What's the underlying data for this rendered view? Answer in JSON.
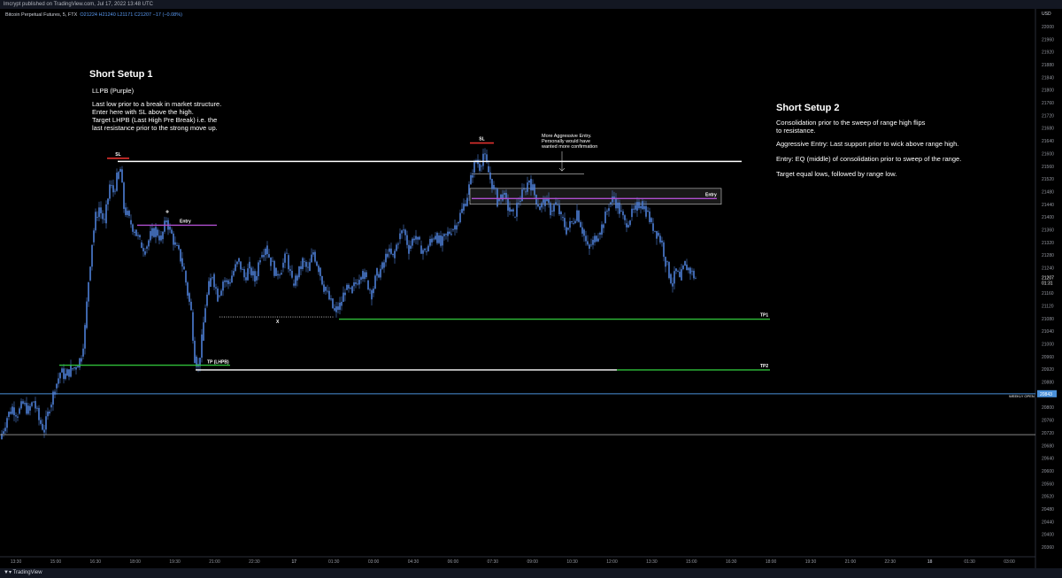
{
  "header": {
    "published": "lmcrypt published on TradingView.com, Jul 17, 2022 13:48 UTC",
    "symbol": "Bitcoin Perpetual Futures, 5, FTX",
    "ohlc_o": "O21224",
    "ohlc_h": "H21240",
    "ohlc_l": "L21171",
    "ohlc_c": "C21207",
    "change": "−17 (−0.08%)"
  },
  "footer": {
    "brand": "TradingView"
  },
  "colors": {
    "background": "#000000",
    "candle": "#4e7fd6",
    "white_line": "#ffffff",
    "green_line": "#2fbf3a",
    "purple_line": "#b04fd1",
    "red_line": "#e0312e",
    "weekly_open_line": "#4a90d9",
    "box_fill": "#2a2a2a",
    "box_border": "#cfcfcf"
  },
  "chart_data": {
    "type": "candlestick",
    "currency": "USD",
    "ylim": [
      20340,
      22040
    ],
    "y_ticks": [
      22000,
      21960,
      21920,
      21880,
      21840,
      21800,
      21760,
      21720,
      21680,
      21640,
      21600,
      21560,
      21520,
      21480,
      21440,
      21400,
      21360,
      21320,
      21280,
      21240,
      21200,
      21160,
      21120,
      21080,
      21040,
      21000,
      20960,
      20920,
      20880,
      20840,
      20800,
      20760,
      20720,
      20680,
      20640,
      20600,
      20560,
      20520,
      20480,
      20440,
      20400,
      20360
    ],
    "x_ticks": [
      "13:30",
      "15:00",
      "16:30",
      "18:00",
      "19:30",
      "21:00",
      "22:30",
      "17",
      "01:30",
      "03:00",
      "04:30",
      "06:00",
      "07:30",
      "09:00",
      "10:30",
      "12:00",
      "13:30",
      "15:00",
      "16:30",
      "18:00",
      "19:30",
      "21:00",
      "22:30",
      "18",
      "01:30",
      "03:00"
    ],
    "last_price_label": "21207",
    "countdown_label": "01:31",
    "weekly_open": {
      "value": 20843,
      "label": "20843",
      "tag": "WEEKLY OPEN"
    },
    "close_path": [
      [
        0,
        20700
      ],
      [
        8,
        20770
      ],
      [
        14,
        20800
      ],
      [
        20,
        20780
      ],
      [
        26,
        20810
      ],
      [
        32,
        20790
      ],
      [
        38,
        20820
      ],
      [
        44,
        20760
      ],
      [
        50,
        20730
      ],
      [
        56,
        20800
      ],
      [
        62,
        20860
      ],
      [
        68,
        20910
      ],
      [
        74,
        20900
      ],
      [
        80,
        20920
      ],
      [
        86,
        20930
      ],
      [
        92,
        20960
      ],
      [
        96,
        21050
      ],
      [
        100,
        21200
      ],
      [
        104,
        21320
      ],
      [
        108,
        21400
      ],
      [
        112,
        21430
      ],
      [
        118,
        21380
      ],
      [
        124,
        21500
      ],
      [
        128,
        21480
      ],
      [
        132,
        21520
      ],
      [
        136,
        21550
      ],
      [
        140,
        21430
      ],
      [
        146,
        21390
      ],
      [
        152,
        21360
      ],
      [
        158,
        21320
      ],
      [
        164,
        21300
      ],
      [
        170,
        21340
      ],
      [
        176,
        21360
      ],
      [
        182,
        21330
      ],
      [
        188,
        21390
      ],
      [
        192,
        21360
      ],
      [
        198,
        21310
      ],
      [
        204,
        21270
      ],
      [
        208,
        21230
      ],
      [
        212,
        21160
      ],
      [
        216,
        21100
      ],
      [
        220,
        20960
      ],
      [
        224,
        20930
      ],
      [
        228,
        21010
      ],
      [
        232,
        21120
      ],
      [
        236,
        21180
      ],
      [
        240,
        21220
      ],
      [
        246,
        21150
      ],
      [
        252,
        21200
      ],
      [
        258,
        21190
      ],
      [
        264,
        21230
      ],
      [
        270,
        21260
      ],
      [
        276,
        21210
      ],
      [
        282,
        21240
      ],
      [
        288,
        21200
      ],
      [
        294,
        21280
      ],
      [
        300,
        21310
      ],
      [
        306,
        21260
      ],
      [
        312,
        21220
      ],
      [
        318,
        21240
      ],
      [
        324,
        21280
      ],
      [
        330,
        21190
      ],
      [
        336,
        21210
      ],
      [
        342,
        21260
      ],
      [
        348,
        21230
      ],
      [
        354,
        21290
      ],
      [
        360,
        21240
      ],
      [
        366,
        21180
      ],
      [
        372,
        21140
      ],
      [
        378,
        21100
      ],
      [
        384,
        21120
      ],
      [
        390,
        21170
      ],
      [
        396,
        21160
      ],
      [
        402,
        21190
      ],
      [
        408,
        21230
      ],
      [
        414,
        21200
      ],
      [
        420,
        21160
      ],
      [
        426,
        21220
      ],
      [
        432,
        21240
      ],
      [
        438,
        21290
      ],
      [
        444,
        21270
      ],
      [
        450,
        21330
      ],
      [
        456,
        21360
      ],
      [
        462,
        21300
      ],
      [
        468,
        21340
      ],
      [
        474,
        21310
      ],
      [
        480,
        21290
      ],
      [
        486,
        21320
      ],
      [
        492,
        21350
      ],
      [
        498,
        21310
      ],
      [
        504,
        21340
      ],
      [
        510,
        21360
      ],
      [
        516,
        21380
      ],
      [
        522,
        21420
      ],
      [
        528,
        21470
      ],
      [
        534,
        21540
      ],
      [
        538,
        21580
      ],
      [
        542,
        21560
      ],
      [
        546,
        21600
      ],
      [
        550,
        21560
      ],
      [
        554,
        21520
      ],
      [
        558,
        21490
      ],
      [
        562,
        21450
      ],
      [
        568,
        21470
      ],
      [
        574,
        21430
      ],
      [
        580,
        21400
      ],
      [
        586,
        21450
      ],
      [
        592,
        21480
      ],
      [
        598,
        21520
      ],
      [
        604,
        21470
      ],
      [
        610,
        21430
      ],
      [
        616,
        21450
      ],
      [
        622,
        21420
      ],
      [
        628,
        21440
      ],
      [
        634,
        21400
      ],
      [
        640,
        21360
      ],
      [
        646,
        21380
      ],
      [
        652,
        21420
      ],
      [
        658,
        21360
      ],
      [
        664,
        21300
      ],
      [
        670,
        21320
      ],
      [
        676,
        21350
      ],
      [
        682,
        21380
      ],
      [
        688,
        21440
      ],
      [
        694,
        21460
      ],
      [
        700,
        21420
      ],
      [
        706,
        21380
      ],
      [
        712,
        21400
      ],
      [
        718,
        21420
      ],
      [
        724,
        21450
      ],
      [
        730,
        21420
      ],
      [
        736,
        21380
      ],
      [
        742,
        21350
      ],
      [
        748,
        21320
      ],
      [
        752,
        21260
      ],
      [
        756,
        21220
      ],
      [
        760,
        21190
      ],
      [
        764,
        21230
      ],
      [
        768,
        21200
      ],
      [
        774,
        21250
      ],
      [
        780,
        21230
      ],
      [
        786,
        21207
      ]
    ],
    "levels": [
      {
        "name": "SL range high",
        "value": 21575,
        "color": "white",
        "x1": 133,
        "x2": 838,
        "label": ""
      },
      {
        "name": "TP1",
        "value": 21078,
        "color": "green",
        "x1": 383,
        "x2": 870,
        "label": "TP1"
      },
      {
        "name": "TP2 white",
        "value": 20918,
        "color": "white",
        "x1": 221,
        "x2": 697,
        "label": ""
      },
      {
        "name": "TP2 green",
        "value": 20918,
        "color": "green",
        "x1": 697,
        "x2": 870,
        "label": "TP2"
      },
      {
        "name": "TP (LHPB)",
        "value": 20933,
        "color": "green",
        "x1": 67,
        "x2": 260,
        "label": "TP (LHPB)"
      },
      {
        "name": "Entry 1",
        "value": 21374,
        "color": "purple",
        "x1": 155,
        "x2": 245,
        "label": "Entry"
      },
      {
        "name": "Entry 2",
        "value": 21458,
        "color": "purple",
        "x1": 533,
        "x2": 810,
        "label": "Entry"
      },
      {
        "name": "SL1",
        "value": 21585,
        "color": "red",
        "x1": 121,
        "x2": 146,
        "label": "SL"
      },
      {
        "name": "SL2",
        "value": 21633,
        "color": "red",
        "x1": 531,
        "x2": 558,
        "label": "SL"
      },
      {
        "name": "range low",
        "value": 20714,
        "color": "gray",
        "x1": 0,
        "x2": 1170,
        "label": ""
      }
    ],
    "annotations_marks": {
      "x_label": "X",
      "dotted_level": 21085,
      "plus_marker": "+"
    }
  },
  "annotations": {
    "setup1_title": "Short Setup 1",
    "setup1_sub": "LLPB (Purple)",
    "setup1_body": "Last low prior to a break in market structure.\nEnter here with SL above the high.\nTarget LHPB (Last High Pre Break) i.e. the\nlast resistance prior to the strong move up.",
    "setup2_title": "Short Setup 2",
    "setup2_body1": "Consolidation prior to the sweep of range high flips\nto resistance.",
    "setup2_body2": "Aggressive Entry: Last support prior to wick above range high.",
    "setup2_body3": "Entry: EQ (middle) of consolidation prior to sweep of the range.",
    "setup2_body4": "Target equal lows, followed by range low.",
    "aggressive_note": "More Aggressive Entry.\nPersonally would have\nwanted more confirmation"
  }
}
